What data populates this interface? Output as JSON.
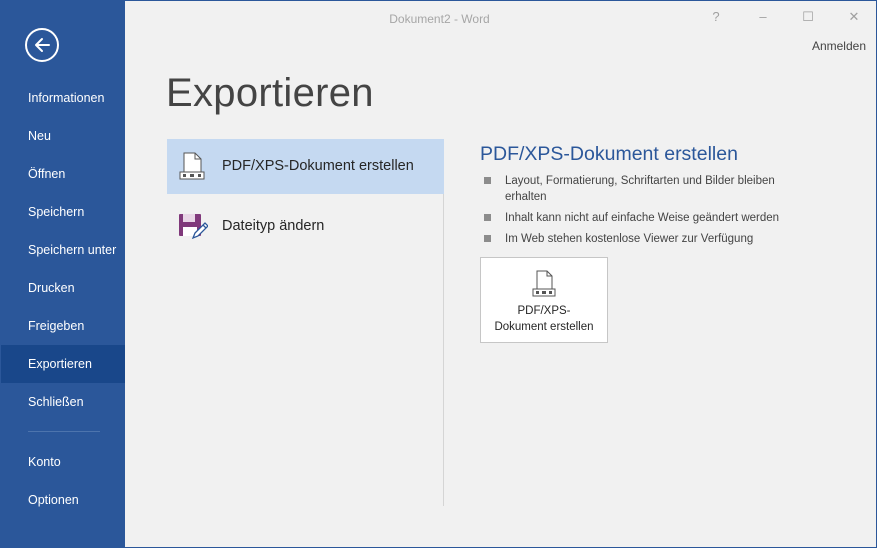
{
  "window": {
    "title": "Dokument2 - Word",
    "help_label": "?",
    "minimize_label": "–",
    "maximize_label": "☐",
    "close_label": "✕",
    "signin_label": "Anmelden"
  },
  "sidebar": {
    "back_icon": "arrow-left-icon",
    "items": [
      {
        "label": "Informationen",
        "active": false
      },
      {
        "label": "Neu",
        "active": false
      },
      {
        "label": "Öffnen",
        "active": false
      },
      {
        "label": "Speichern",
        "active": false
      },
      {
        "label": "Speichern unter",
        "active": false
      },
      {
        "label": "Drucken",
        "active": false
      },
      {
        "label": "Freigeben",
        "active": false
      },
      {
        "label": "Exportieren",
        "active": true
      },
      {
        "label": "Schließen",
        "active": false
      }
    ],
    "bottom_items": [
      {
        "label": "Konto"
      },
      {
        "label": "Optionen"
      }
    ]
  },
  "main": {
    "title": "Exportieren",
    "options": [
      {
        "label": "PDF/XPS-Dokument erstellen",
        "icon": "pdf-document-icon",
        "selected": true
      },
      {
        "label": "Dateityp ändern",
        "icon": "floppy-disk-pen-icon",
        "selected": false
      }
    ],
    "detail": {
      "title": "PDF/XPS-Dokument erstellen",
      "bullets": [
        "Layout, Formatierung, Schriftarten und Bilder bleiben erhalten",
        "Inhalt kann nicht auf einfache Weise geändert werden",
        "Im Web stehen kostenlose Viewer zur Verfügung"
      ],
      "button_line1": "PDF/XPS-",
      "button_line2": "Dokument erstellen",
      "button_icon": "pdf-document-icon"
    }
  },
  "colors": {
    "accent": "#2b579a",
    "sidebar_active": "#19478a",
    "option_selected": "#c5d9f1",
    "floppy": "#80397b"
  }
}
